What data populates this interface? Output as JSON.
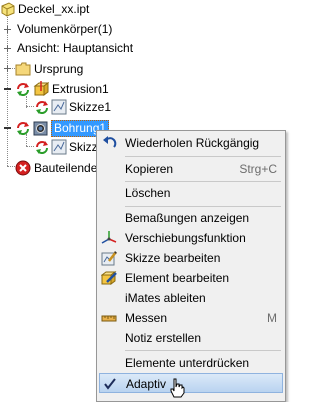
{
  "tree": {
    "root": "Deckel_xx.ipt",
    "volumenkoerper": "Volumenkörper(1)",
    "ansicht": "Ansicht: Hauptansicht",
    "ursprung": "Ursprung",
    "extrusion": "Extrusion1",
    "skizze1": "Skizze1",
    "bohrung": "Bohrung1",
    "skizze_partial": "Skizze",
    "bauteilende": "Bauteilende"
  },
  "menu": {
    "items": [
      {
        "label": "Wiederholen Rückgängig",
        "shortcut": ""
      },
      {
        "label": "Kopieren",
        "shortcut": "Strg+C"
      },
      {
        "label": "Löschen",
        "shortcut": ""
      },
      {
        "label": "Bemaßungen anzeigen",
        "shortcut": ""
      },
      {
        "label": "Verschiebungsfunktion",
        "shortcut": ""
      },
      {
        "label": "Skizze bearbeiten",
        "shortcut": ""
      },
      {
        "label": "Element bearbeiten",
        "shortcut": ""
      },
      {
        "label": "iMates ableiten",
        "shortcut": ""
      },
      {
        "label": "Messen",
        "shortcut": "M"
      },
      {
        "label": "Notiz erstellen",
        "shortcut": ""
      },
      {
        "label": "Elemente unterdrücken",
        "shortcut": ""
      },
      {
        "label": "Adaptiv",
        "shortcut": ""
      }
    ]
  },
  "icons": {
    "part": "part-icon",
    "folder": "folder-icon",
    "update": "update-arrows-icon",
    "extrusion": "extrusion-feature-icon",
    "sketch": "sketch-icon",
    "hole": "hole-feature-icon",
    "end": "end-of-part-icon",
    "undo": "undo-icon",
    "move": "move-axes-icon",
    "edit_sketch": "edit-sketch-icon",
    "edit_feature": "edit-feature-icon",
    "measure": "ruler-icon",
    "check": "check-icon",
    "cursor": "hand-cursor-icon"
  },
  "colors": {
    "selection": "#3399ff",
    "highlight": "#c8ddf4",
    "update_red": "#d42020",
    "update_green": "#2a9d2a"
  }
}
